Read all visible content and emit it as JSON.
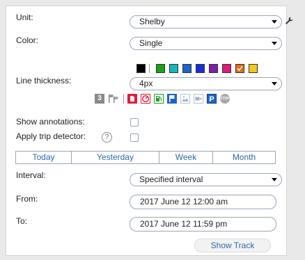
{
  "labels": {
    "unit": "Unit:",
    "color": "Color:",
    "line_thickness": "Line thickness:",
    "show_annotations": "Show annotations:",
    "apply_trip_detector": "Apply trip detector:",
    "interval": "Interval:",
    "from": "From:",
    "to": "To:"
  },
  "unit": {
    "value": "Shelby"
  },
  "color": {
    "value": "Single",
    "swatches": [
      "#000000",
      "#1aa31a",
      "#14b8b8",
      "#1a66cc",
      "#1a2ed6",
      "#7a1fa8",
      "#e0197a",
      "#e86a10",
      "#f2c81a"
    ],
    "selected_index": 7
  },
  "line_thickness": {
    "value": "4px"
  },
  "toolbar": {
    "badge_number": "3",
    "icons": [
      "number-badge-icon",
      "flags-icon",
      "document-icon",
      "gauge-icon",
      "fuel-icon",
      "flag-icon",
      "image-icon",
      "video-icon",
      "parking-icon",
      "stop-icon"
    ],
    "parking_label": "P",
    "stop_label": "STOP"
  },
  "checkboxes": {
    "show_annotations": false,
    "apply_trip_detector": false
  },
  "help_glyph": "?",
  "period_buttons": [
    "Today",
    "Yesterday",
    "Week",
    "Month"
  ],
  "interval": {
    "value": "Specified interval"
  },
  "from": {
    "value": "2017 June 12 12:00 am"
  },
  "to": {
    "value": "2017 June 12 11:59 pm"
  },
  "show_track_label": "Show Track",
  "colors": {
    "accent": "#2b6aa8",
    "border": "#9aa6b8"
  }
}
